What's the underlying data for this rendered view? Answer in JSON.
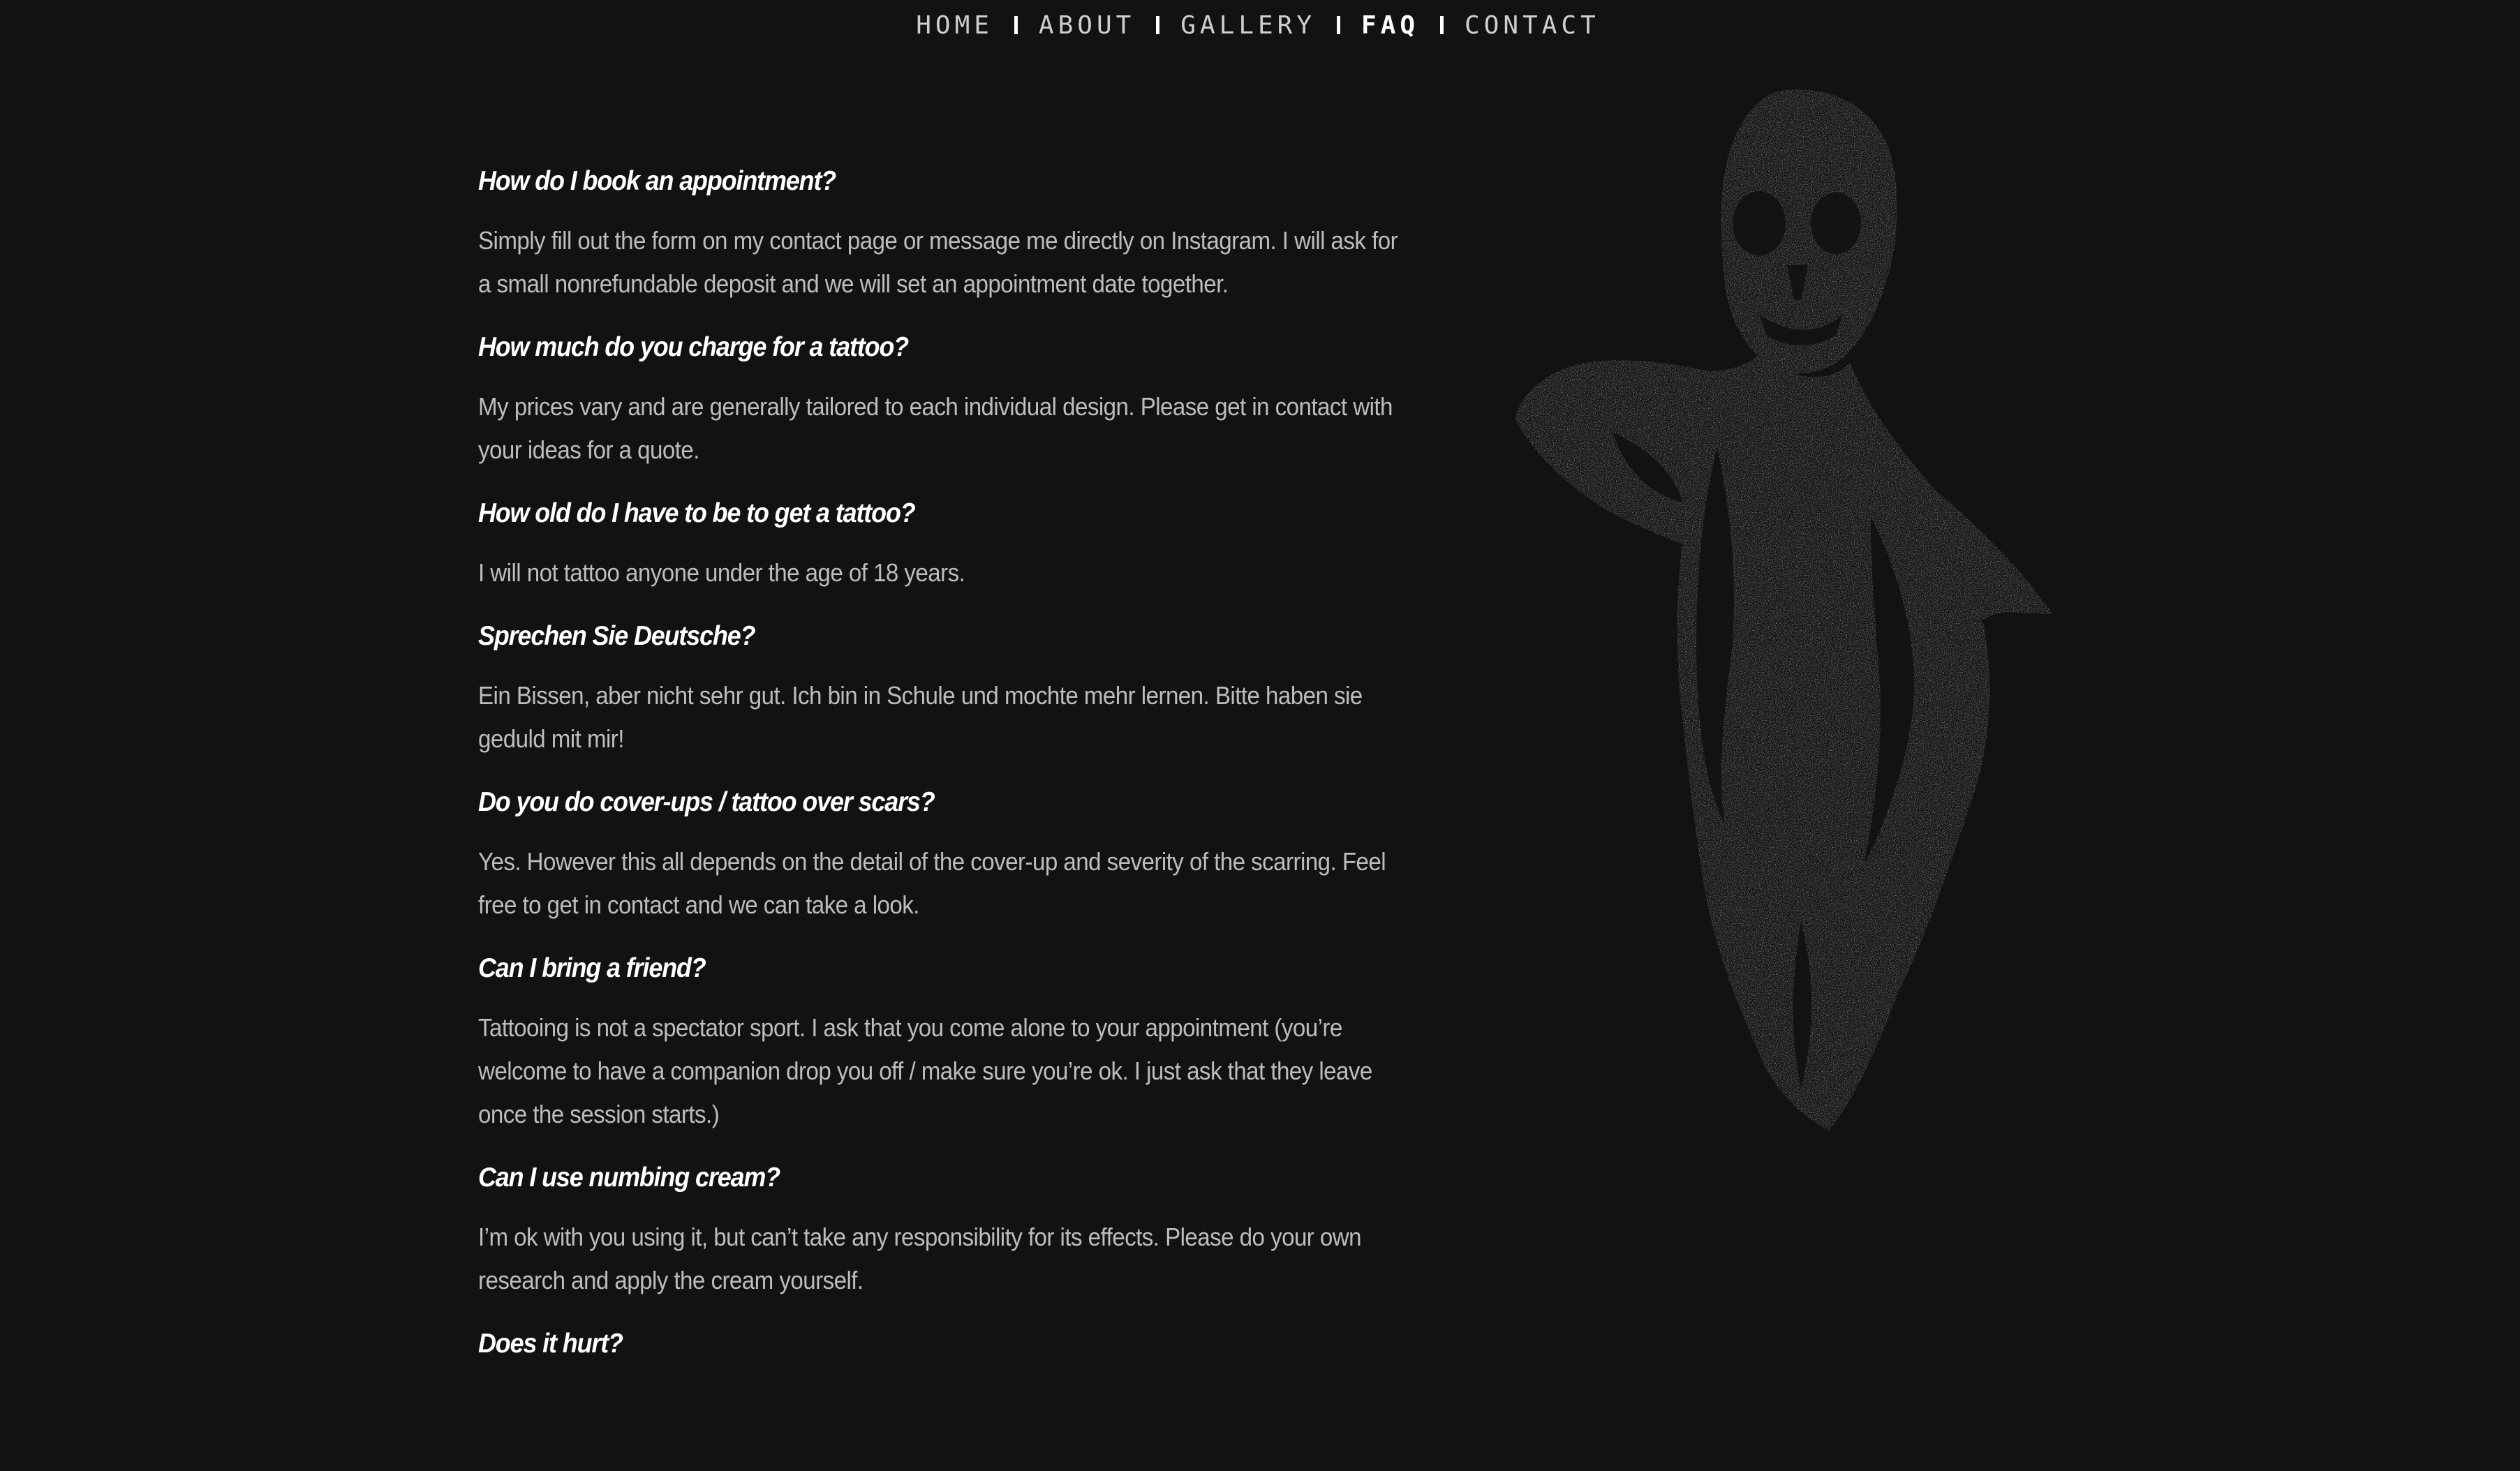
{
  "nav": {
    "items": [
      {
        "label": "HOME",
        "active": false
      },
      {
        "label": "ABOUT",
        "active": false
      },
      {
        "label": "GALLERY",
        "active": false
      },
      {
        "label": "FAQ",
        "active": true
      },
      {
        "label": "CONTACT",
        "active": false
      }
    ]
  },
  "faq": [
    {
      "question": "How do I book an appointment?",
      "answer": "Simply fill out the form on my contact page or message me directly on Instagram. I will ask for a small nonrefundable deposit and we will set an appointment date together."
    },
    {
      "question": "How much do you charge for a tattoo?",
      "answer": "My prices vary and are generally tailored to each individual design. Please get in contact with your ideas for a quote."
    },
    {
      "question": "How old do I have to be to get a tattoo?",
      "answer": "I will not tattoo anyone under the age of 18 years."
    },
    {
      "question": "Sprechen Sie Deutsche?",
      "answer": "Ein Bissen, aber nicht sehr gut. Ich bin in Schule und mochte mehr lernen. Bitte haben sie geduld mit mir!"
    },
    {
      "question": "Do you do cover-ups / tattoo over scars?",
      "answer": "Yes. However this all depends on the detail of the cover-up and severity of the scarring. Feel free to get in contact and we can take a look."
    },
    {
      "question": "Can I bring a friend?",
      "answer": "Tattooing is not a spectator sport. I ask that you come alone to your appointment (you’re welcome to have a companion drop you off / make sure you’re ok. I just ask that they leave once the session starts.)"
    },
    {
      "question": "Can I use numbing cream?",
      "answer": "I’m ok with you using it, but can’t take any responsibility for its effects. Please do your own research and apply the cream yourself."
    },
    {
      "question": "Does it hurt?",
      "answer": ""
    }
  ],
  "colors": {
    "background": "#121212",
    "question": "#ffffff",
    "answer": "#bdbdbd",
    "art": "#a8a8a8"
  },
  "art": {
    "icon": "decayed-figure-illustration"
  }
}
